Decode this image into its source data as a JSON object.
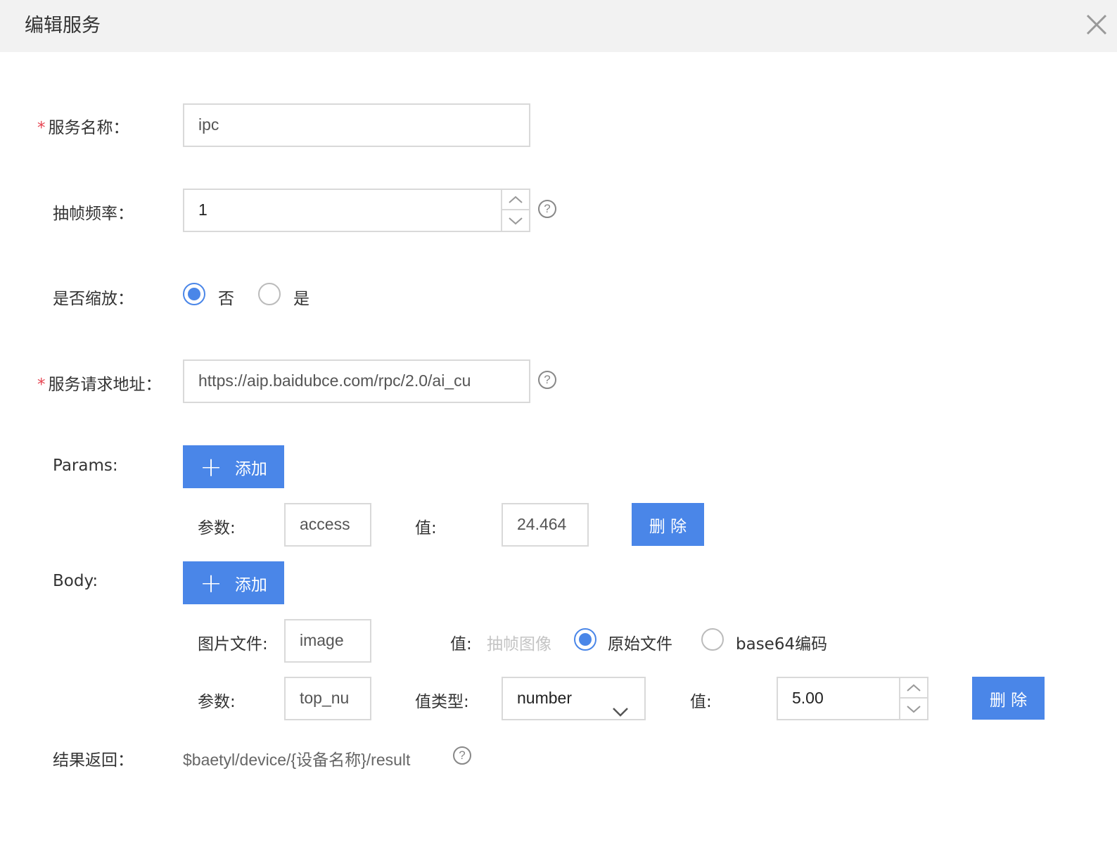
{
  "dialog": {
    "title": "编辑服务"
  },
  "form": {
    "service_name": {
      "label": "服务名称：",
      "required_mark": "*",
      "value": "ipc"
    },
    "frame_rate": {
      "label": "抽帧频率：",
      "value": "1"
    },
    "scale": {
      "label": "是否缩放：",
      "options": [
        "否",
        "是"
      ],
      "selected": "否"
    },
    "service_url": {
      "label": "服务请求地址：",
      "required_mark": "*",
      "value": "https://aip.baidubce.com/rpc/2.0/ai_cu"
    },
    "params": {
      "label": "Params:",
      "add_label": "添加",
      "rows": [
        {
          "param_label": "参数:",
          "param_value": "access",
          "value_label": "值:",
          "value": "24.464",
          "delete_label": "删 除"
        }
      ]
    },
    "body": {
      "label": "Body:",
      "add_label": "添加",
      "image_row": {
        "label": "图片文件:",
        "value": "image",
        "value_label": "值:",
        "options": [
          "抽帧图像",
          "原始文件",
          "base64编码"
        ],
        "selected": "原始文件"
      },
      "param_row": {
        "param_label": "参数:",
        "param_value": "top_nu",
        "type_label": "值类型:",
        "type_value": "number",
        "value_label": "值:",
        "value": "5.00",
        "delete_label": "删 除"
      }
    },
    "result": {
      "label": "结果返回：",
      "value": "$baetyl/device/{设备名称}/result"
    }
  },
  "colors": {
    "accent": "#4a86e8",
    "required": "#e64552",
    "header_bg": "#f2f2f2",
    "border": "#d9d9d9"
  },
  "icons": [
    "close-icon",
    "help-icon",
    "chevron-up-icon",
    "chevron-down-icon",
    "plus-icon"
  ]
}
